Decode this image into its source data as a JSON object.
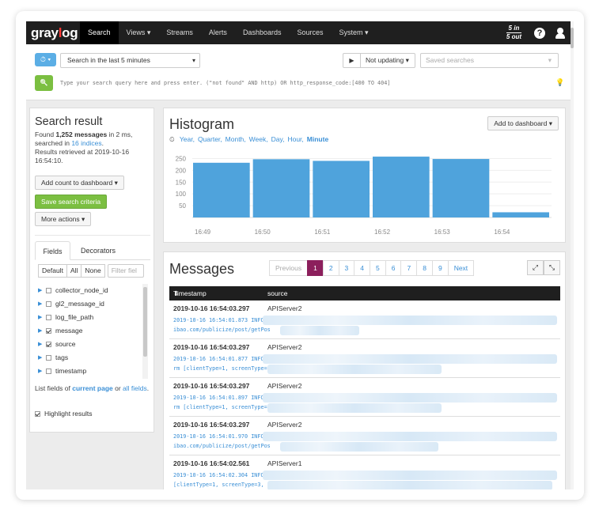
{
  "nav": {
    "logo": "graylog",
    "items": [
      "Search",
      "Views ▾",
      "Streams",
      "Alerts",
      "Dashboards",
      "Sources",
      "System ▾"
    ],
    "throughput_in": "5 in",
    "throughput_out": "5 out",
    "help": "?"
  },
  "search": {
    "time_button": "⏱ ▾",
    "time_range": "Search in the last 5 minutes",
    "play": "▶",
    "refresh": "Not updating ▾",
    "saved_placeholder": "Saved searches",
    "go": "🔍",
    "query_placeholder": "Type your search query here and press enter. (\"not found\" AND http) OR http_response_code:[400 TO 404]",
    "tip_icon": "💡"
  },
  "result": {
    "title": "Search result",
    "found_prefix": "Found ",
    "count": "1,252 messages",
    "found_mid": " in 2 ms, searched in ",
    "indices": "16 indices",
    "found_suffix": ".",
    "retrieved": "Results retrieved at 2019-10-16 16:54:10.",
    "add_count": "Add count to dashboard ▾",
    "save_criteria": "Save search criteria",
    "more_actions": "More actions ▾",
    "tabs": [
      "Fields",
      "Decorators"
    ],
    "field_buttons": [
      "Default",
      "All",
      "None"
    ],
    "filter_placeholder": "Filter fiel",
    "fields": [
      {
        "name": "collector_node_id",
        "checked": false
      },
      {
        "name": "gl2_message_id",
        "checked": false
      },
      {
        "name": "log_file_path",
        "checked": false
      },
      {
        "name": "message",
        "checked": true
      },
      {
        "name": "source",
        "checked": true
      },
      {
        "name": "tags",
        "checked": false
      },
      {
        "name": "timestamp",
        "checked": false
      }
    ],
    "list_prefix": "List fields of ",
    "current_page": "current page",
    "list_or": " or ",
    "all_fields": "all fields",
    "list_suffix": ".",
    "highlight": "Highlight results"
  },
  "histogram": {
    "title": "Histogram",
    "resolutions": [
      "Year,",
      "Quarter,",
      "Month,",
      "Week,",
      "Day,",
      "Hour,",
      "Minute"
    ],
    "selected_resolution": "Minute",
    "add_button": "Add to dashboard ▾"
  },
  "chart_data": {
    "type": "bar",
    "categories": [
      "16:49",
      "16:50",
      "16:51",
      "16:52",
      "16:53",
      "16:54"
    ],
    "values": [
      232,
      247,
      240,
      258,
      248,
      22
    ],
    "yticks": [
      50,
      100,
      150,
      200,
      250
    ],
    "ylim": [
      0,
      275
    ],
    "bar_color": "#4fa3dc"
  },
  "messages": {
    "title": "Messages",
    "pager": [
      "Previous",
      "1",
      "2",
      "3",
      "4",
      "5",
      "6",
      "7",
      "8",
      "9",
      "Next"
    ],
    "active_page": "1",
    "col_timestamp": "Timestamp",
    "col_source": "source",
    "rows": [
      {
        "ts": "2019-10-16 16:54:03.297",
        "src": "APIServer2",
        "line1": "2019-10-16 16:54:01.873 INFO",
        "line2": "ibao.com/publicize/post/getPos"
      },
      {
        "ts": "2019-10-16 16:54:03.297",
        "src": "APIServer2",
        "line1": "2019-10-16 16:54:01.877 INFO",
        "line2": "rm [clientType=1, screenType="
      },
      {
        "ts": "2019-10-16 16:54:03.297",
        "src": "APIServer2",
        "line1": "2019-10-16 16:54:01.897 INFO",
        "line2": "rm [clientType=1, screenType="
      },
      {
        "ts": "2019-10-16 16:54:03.297",
        "src": "APIServer2",
        "line1": "2019-10-16 16:54:01.970 INFO",
        "line2": "ibao.com/publicize/post/getPos"
      },
      {
        "ts": "2019-10-16 16:54:02.561",
        "src": "APIServer1",
        "line1": "2019-10-16 16:54:02.304 INFO",
        "line2": "[clientType=1, screenType=3,"
      }
    ]
  }
}
